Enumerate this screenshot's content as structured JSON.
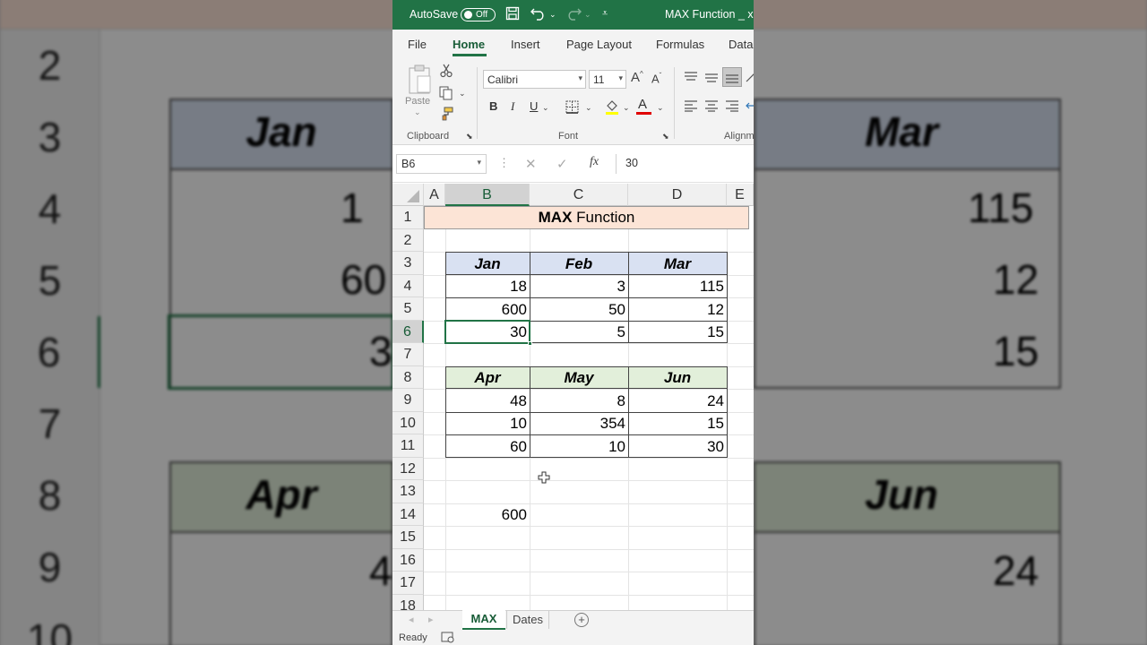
{
  "titlebar": {
    "autosave_label": "AutoSave",
    "autosave_state": "Off",
    "file_name": "MAX Function _ xlsx"
  },
  "ribbon_tabs": [
    "File",
    "Home",
    "Insert",
    "Page Layout",
    "Formulas",
    "Data"
  ],
  "active_tab": "Home",
  "ribbon": {
    "paste_label": "Paste",
    "clipboard_group": "Clipboard",
    "font_name": "Calibri",
    "font_size": "11",
    "font_group": "Font",
    "alignment_group": "Alignm",
    "bold": "B",
    "italic": "I",
    "underline": "U",
    "font_color_glyph": "A",
    "grow_font": "A",
    "shrink_font": "A"
  },
  "formula_bar": {
    "name_box": "B6",
    "fx": "fx",
    "value": "30"
  },
  "columns": [
    "A",
    "B",
    "C",
    "D",
    "E"
  ],
  "selected_column": "B",
  "rows": [
    "1",
    "2",
    "3",
    "4",
    "5",
    "6",
    "7",
    "8",
    "9",
    "10",
    "11",
    "12",
    "13",
    "14",
    "15",
    "16",
    "17",
    "18"
  ],
  "selected_row": "6",
  "sheet": {
    "title_bold": "MAX",
    "title_rest": " Function",
    "table1": {
      "headers": [
        "Jan",
        "Feb",
        "Mar"
      ],
      "rows": [
        [
          "18",
          "3",
          "115"
        ],
        [
          "600",
          "50",
          "12"
        ],
        [
          "30",
          "5",
          "15"
        ]
      ]
    },
    "table2": {
      "headers": [
        "Apr",
        "May",
        "Jun"
      ],
      "rows": [
        [
          "48",
          "8",
          "24"
        ],
        [
          "10",
          "354",
          "15"
        ],
        [
          "60",
          "10",
          "30"
        ]
      ]
    },
    "result": "600"
  },
  "sheet_tabs": [
    "MAX",
    "Dates"
  ],
  "active_sheet": "MAX",
  "status": {
    "ready": "Ready"
  },
  "background": {
    "rows": [
      "2",
      "3",
      "4",
      "5",
      "6",
      "7",
      "8",
      "9",
      "10"
    ],
    "left_cells": [
      "Jan",
      "1",
      "60",
      "3",
      "Apr",
      "4"
    ],
    "right_cells": [
      "Mar",
      "115",
      "12",
      "15",
      "Jun",
      "24"
    ]
  },
  "colors": {
    "excel_green": "#217346",
    "title_fill": "#fce4d6",
    "table1_header_fill": "#d9e1f2",
    "table2_header_fill": "#e2efda"
  }
}
